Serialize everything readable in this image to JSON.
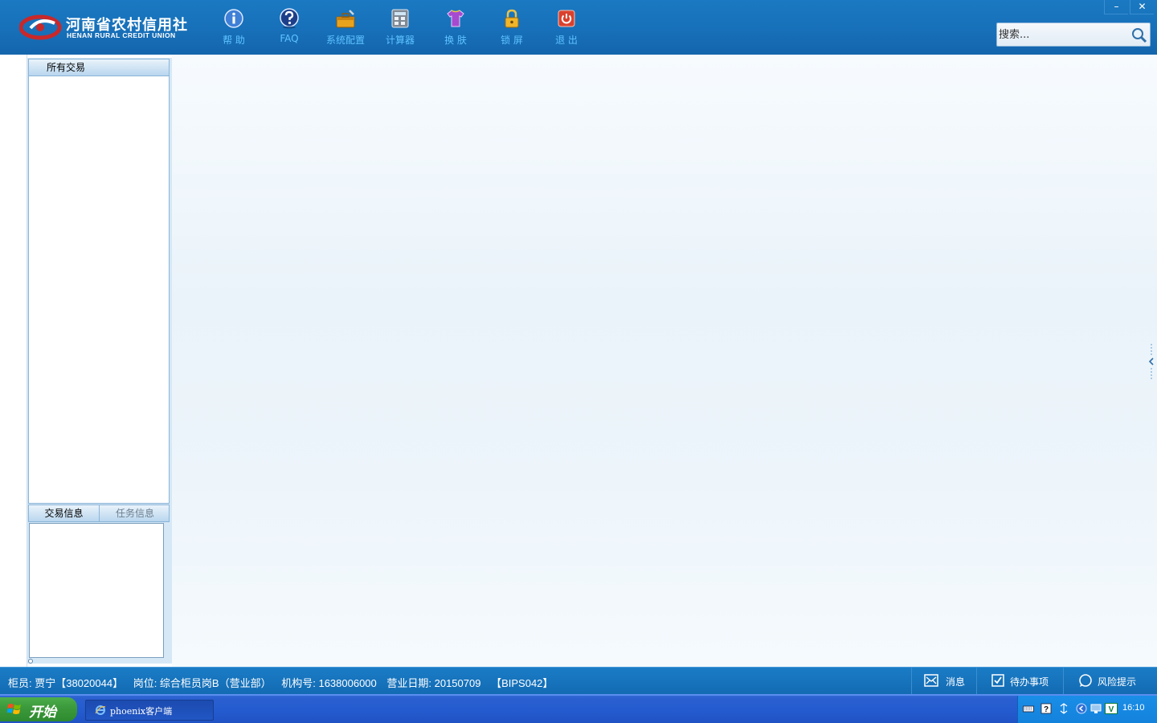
{
  "app": {
    "logo_cn": "河南省农村信用社",
    "logo_en": "HENAN RURAL CREDIT UNION"
  },
  "toolbar": {
    "items": [
      {
        "label": "帮 助",
        "icon": "info-icon"
      },
      {
        "label": "FAQ",
        "icon": "question-icon"
      },
      {
        "label": "系统配置",
        "icon": "toolbox-icon"
      },
      {
        "label": "计算器",
        "icon": "calculator-icon"
      },
      {
        "label": "换 肤",
        "icon": "shirt-icon"
      },
      {
        "label": "锁 屏",
        "icon": "lock-icon"
      },
      {
        "label": "退 出",
        "icon": "power-icon"
      }
    ]
  },
  "window_controls": {
    "minimize": "–",
    "close": "✕"
  },
  "search": {
    "placeholder": "搜索..."
  },
  "side_panel": {
    "top_tab": "所有交易",
    "bottom_tabs": [
      "交易信息",
      "任务信息"
    ]
  },
  "status": {
    "teller": "柜员: 贾宁【38020044】",
    "post": "岗位: 综合柜员岗B（营业部）",
    "org": "机构号: 1638006000",
    "date": "营业日期: 20150709",
    "code": "【BIPS042】",
    "buttons": [
      {
        "label": "消息",
        "icon": "envelope-icon"
      },
      {
        "label": "待办事项",
        "icon": "checkbox-icon"
      },
      {
        "label": "风险提示",
        "icon": "chat-bubble-icon"
      }
    ]
  },
  "taskbar": {
    "start_label": "开始",
    "task_label": "phoenix客户端",
    "clock": "16:10"
  },
  "colors": {
    "header": "#1770b9",
    "toolbar_text": "#5ec3ff",
    "statusbar": "#136bb3",
    "taskbar": "#245ccf",
    "start": "#3c9a3c"
  }
}
